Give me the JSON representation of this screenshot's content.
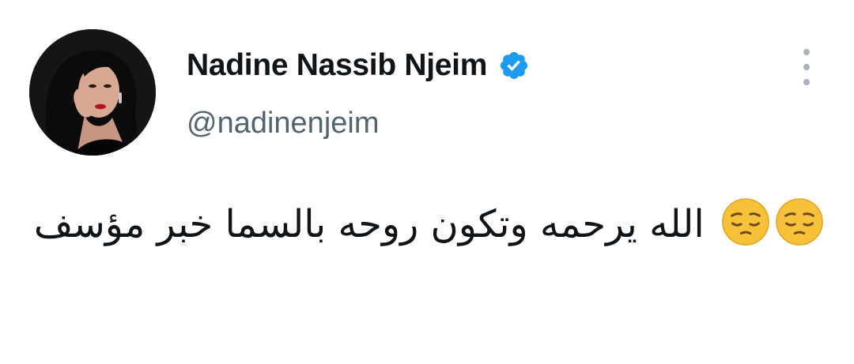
{
  "author": {
    "display_name": "Nadine Nassib Njeim",
    "handle": "@nadinenjeim",
    "verified": true,
    "verified_color": "#1d9bf0",
    "avatar_icon": "profile-photo"
  },
  "tweet": {
    "text_before_emoji": "",
    "text_main": "الله يرحمه وتكون روحه بالسما خبر مؤسف",
    "emoji_names": [
      "pensive-face",
      "pensive-face"
    ],
    "emoji_text": "😔😔"
  },
  "menu": {
    "icon": "more-vertical-icon"
  },
  "colors": {
    "name": "#0f1419",
    "handle": "#536471",
    "more_dots": "#a8b3bd"
  }
}
